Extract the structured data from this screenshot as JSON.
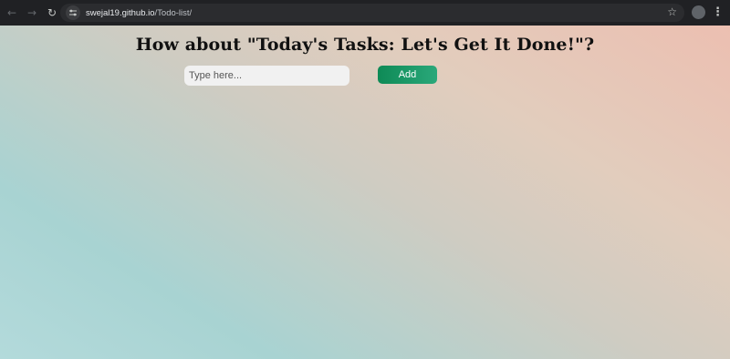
{
  "browser": {
    "url_host": "swejal19.github.io",
    "url_path": "/Todo-list/",
    "icons": [
      "back-arrow-icon",
      "forward-arrow-icon",
      "reload-icon",
      "site-info-icon",
      "bookmark-star-icon",
      "profile-avatar",
      "more-menu-icon"
    ]
  },
  "page": {
    "title": "How about \"Today's Tasks: Let's Get It Done!\"?",
    "input": {
      "value": "",
      "placeholder": "Type here..."
    },
    "add_label": "Add",
    "colors": {
      "gradient_start": "#ecbfb1",
      "gradient_mid": "#cfccc2",
      "gradient_end": "#a8d3d2",
      "button": "#0e8a56"
    }
  }
}
